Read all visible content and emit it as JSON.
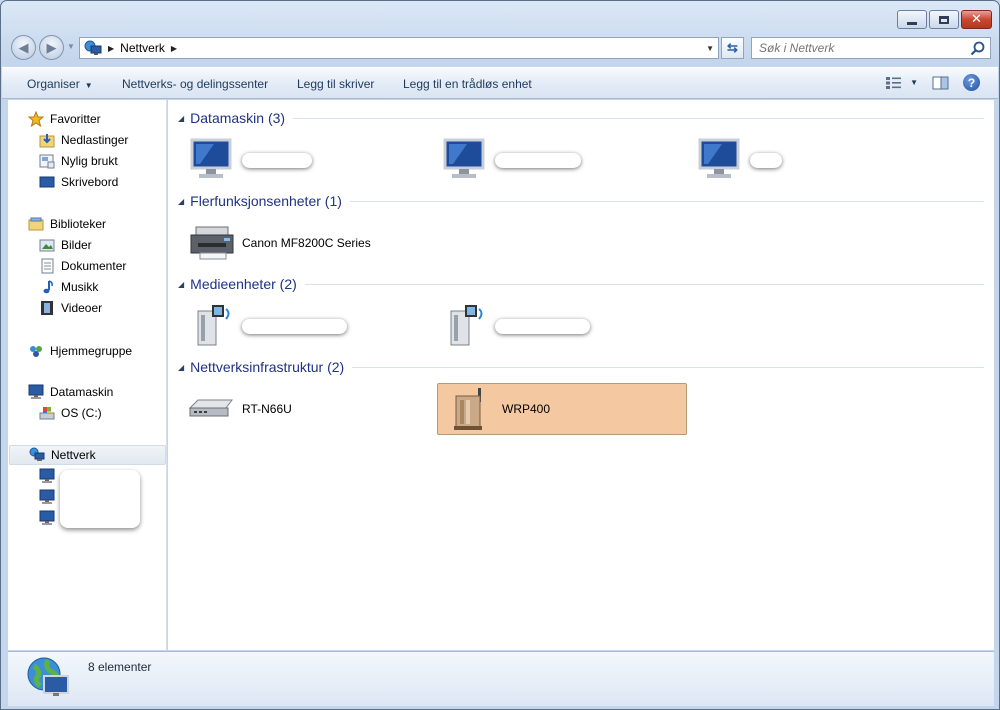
{
  "window": {
    "title": "Nettverk",
    "caption": {
      "minimize": "minimize",
      "maximize": "maximize",
      "close": "✕"
    }
  },
  "address": {
    "breadcrumb": [
      "Nettverk"
    ],
    "search_placeholder": "Søk i Nettverk"
  },
  "toolbar": {
    "organize": "Organiser",
    "network_center": "Nettverks- og delingssenter",
    "add_printer": "Legg til skriver",
    "add_wireless": "Legg til en trådløs enhet"
  },
  "sidebar": {
    "favorites": {
      "label": "Favoritter",
      "items": [
        "Nedlastinger",
        "Nylig brukt",
        "Skrivebord"
      ]
    },
    "libraries": {
      "label": "Biblioteker",
      "items": [
        "Bilder",
        "Dokumenter",
        "Musikk",
        "Videoer"
      ]
    },
    "homegroup": "Hjemmegruppe",
    "computer": {
      "label": "Datamaskin",
      "items": [
        "OS (C:)"
      ]
    },
    "network": {
      "label": "Nettverk"
    }
  },
  "groups": [
    {
      "title": "Datamaskin (3)",
      "items": [
        {
          "label": ""
        },
        {
          "label": ""
        },
        {
          "label": ""
        }
      ]
    },
    {
      "title": "Flerfunksjonsenheter (1)",
      "items": [
        {
          "label": "Canon MF8200C Series"
        }
      ]
    },
    {
      "title": "Medieenheter (2)",
      "items": [
        {
          "label": ""
        },
        {
          "label": ""
        }
      ]
    },
    {
      "title": "Nettverksinfrastruktur (2)",
      "items": [
        {
          "label": "RT-N66U"
        },
        {
          "label": "WRP400"
        }
      ]
    }
  ],
  "status": {
    "count": "8 elementer"
  },
  "colors": {
    "accent": "#1e3287",
    "selection": "#f4c8a0",
    "group_title": "#1e3287"
  }
}
